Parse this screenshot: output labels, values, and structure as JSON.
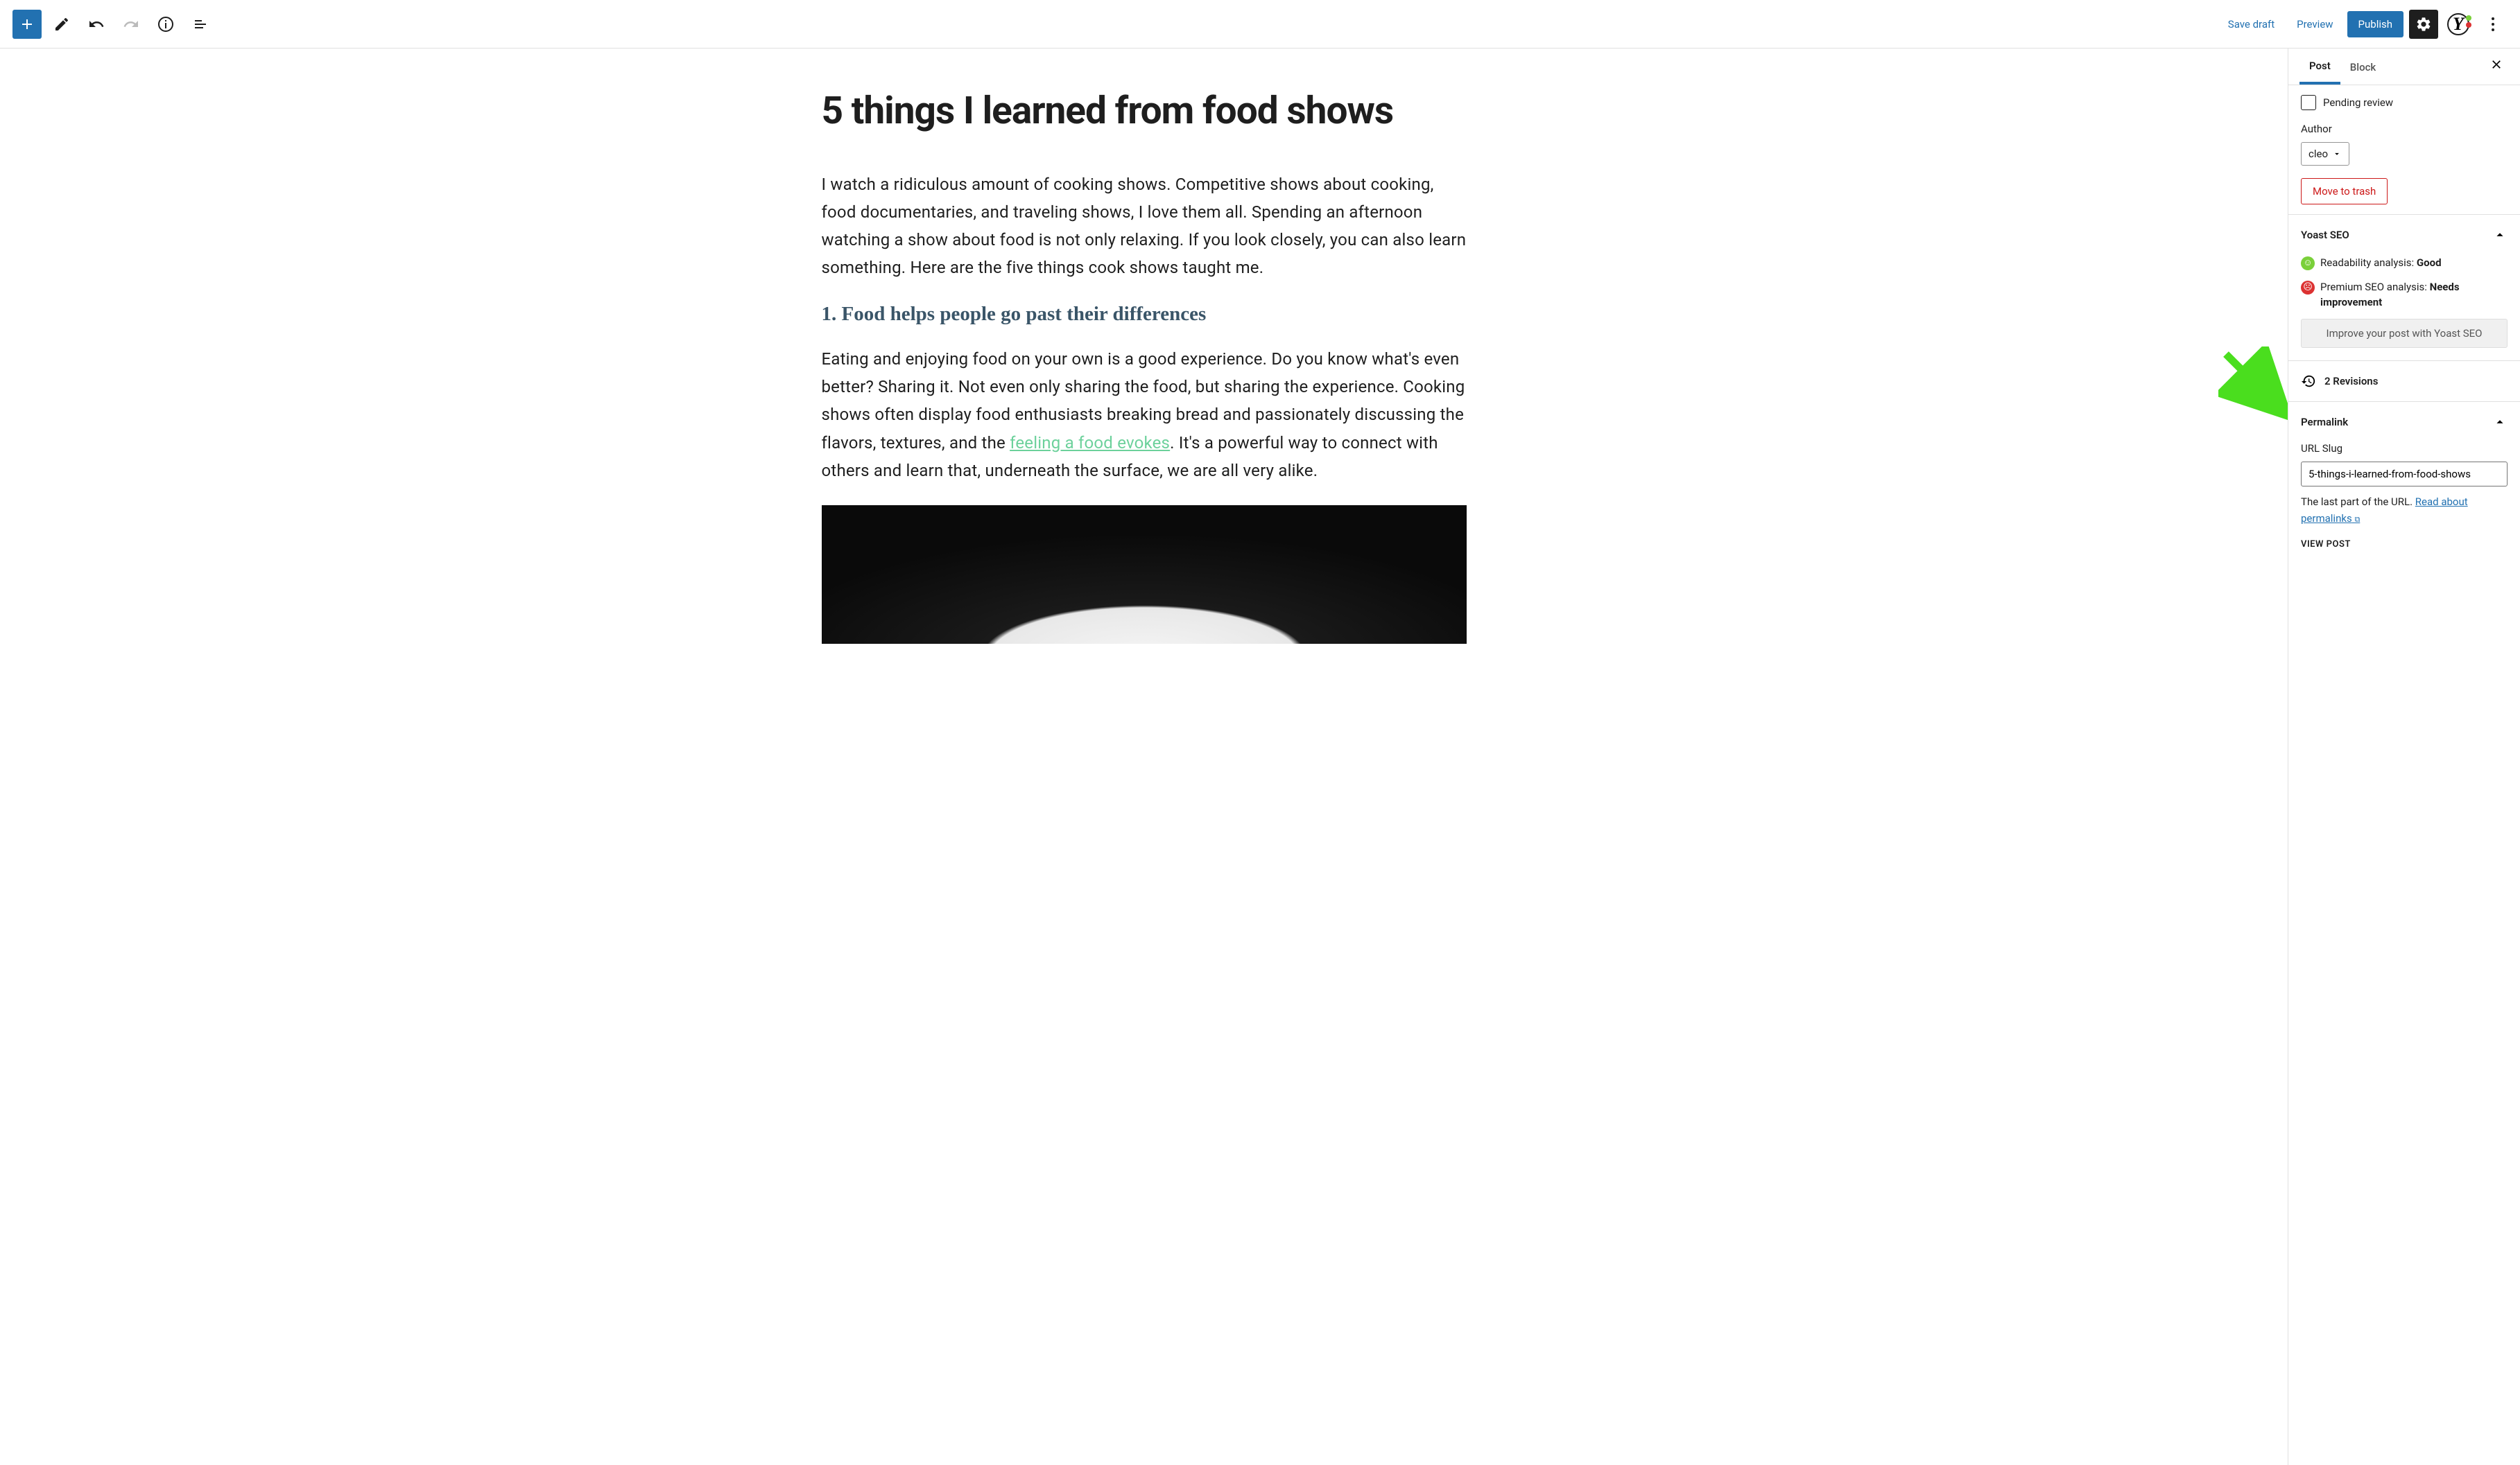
{
  "toolbar": {
    "save_draft": "Save draft",
    "preview": "Preview",
    "publish": "Publish"
  },
  "sidebar": {
    "tabs": {
      "post": "Post",
      "block": "Block"
    },
    "pending_review": "Pending review",
    "author_label": "Author",
    "author_value": "cleo",
    "move_to_trash": "Move to trash",
    "yoast_title": "Yoast SEO",
    "readability_label": "Readability analysis: ",
    "readability_value": "Good",
    "premium_label": "Premium SEO analysis: ",
    "premium_value": "Needs improvement",
    "improve_btn": "Improve your post with Yoast SEO",
    "revisions": "2 Revisions",
    "permalink_title": "Permalink",
    "url_slug_label": "URL Slug",
    "url_slug_value": "5-things-i-learned-from-food-shows",
    "permalink_help_pre": "The last part of the URL. ",
    "permalink_help_link": "Read about permalinks",
    "view_post": "VIEW POST"
  },
  "post": {
    "title": "5 things I learned from food shows",
    "p1": "I watch a ridiculous amount of cooking shows. Competitive shows about cooking, food documentaries, and traveling shows, I love them all. Spending an afternoon watching a show about food is not only relaxing. If you look closely, you can also learn something. Here are the five things cook shows taught me.",
    "h2": "1. Food helps people go past their differences",
    "p2a": "Eating and enjoying food on your own is a good experience. Do you know what's even better? Sharing it. Not even only sharing the food, but sharing the experience. Cooking shows often display food enthusiasts breaking bread and passionately discussing the flavors, textures, and the ",
    "p2_link": "feeling a food evokes",
    "p2b": ". It's a powerful way to connect with others and learn that, underneath the surface, we are all very alike."
  }
}
